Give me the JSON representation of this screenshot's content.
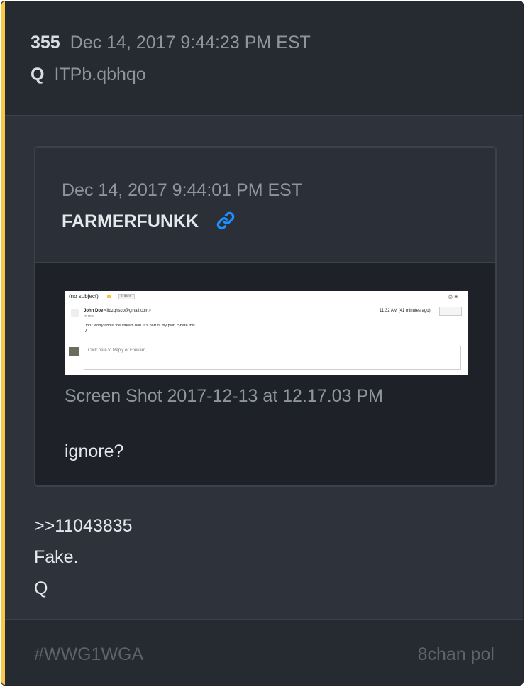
{
  "post": {
    "number": "355",
    "date": "Dec 14, 2017 9:44:23 PM EST",
    "author": "Q",
    "tripcode": "ITPb.qbhqo"
  },
  "quoted_post": {
    "date": "Dec 14, 2017 9:44:01 PM EST",
    "author": "FARMERFUNKK",
    "link_icon": "link-icon",
    "screenshot": {
      "subject": "(no subject)",
      "folder_tag": "Inbox",
      "sender_name": "John Doe",
      "sender_email": "<lfdzqhsco@gmail.com>",
      "to": "to me",
      "time": "11:32 AM (41 minutes ago)",
      "body_line1": "Don't worry about the stream ban. It's part of my plan. Share this.",
      "body_line2": "Q",
      "reply_hint": "Click here to Reply or Forward"
    },
    "caption": "Screen Shot 2017-12-13 at 12.17.03 PM",
    "text": "ignore?"
  },
  "body": {
    "line1": ">>11043835",
    "line2": "Fake.",
    "line3": "Q"
  },
  "footer": {
    "hashtag": "#WWG1WGA",
    "source": "8chan pol"
  },
  "colors": {
    "accent": "#f7c948",
    "card_bg": "#2e323b",
    "link": "#1e90ff"
  }
}
